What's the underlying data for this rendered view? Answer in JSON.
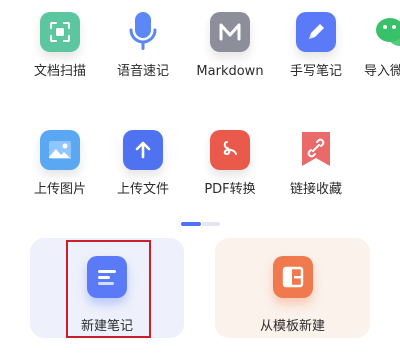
{
  "grid": {
    "row1": [
      {
        "label": "文档扫描",
        "icon": "scan-document-icon",
        "color": "#5cc6a1"
      },
      {
        "label": "语音速记",
        "icon": "microphone-icon",
        "color": "#5b87f7"
      },
      {
        "label": "Markdown",
        "icon": "markdown-m-icon",
        "color": "#8c8f99"
      },
      {
        "label": "手写笔记",
        "icon": "pencil-icon",
        "color": "#5b7af7"
      },
      {
        "label": "导入微",
        "icon": "wechat-icon",
        "color": "#39c16a"
      }
    ],
    "row2": [
      {
        "label": "上传图片",
        "icon": "image-icon",
        "color": "#5aa7f3"
      },
      {
        "label": "上传文件",
        "icon": "upload-arrow-icon",
        "color": "#4f73f0"
      },
      {
        "label": "PDF转换",
        "icon": "pdf-icon",
        "color": "#ea5a4b"
      },
      {
        "label": "链接收藏",
        "icon": "link-bookmark-icon",
        "color": "#ea6a6a"
      }
    ]
  },
  "cards": {
    "new_note": {
      "label": "新建笔记",
      "icon": "note-icon",
      "color": "#5b7af7",
      "bg": "#eef1fb"
    },
    "from_template": {
      "label": "从模板新建",
      "icon": "template-icon",
      "color": "#f07a4d",
      "bg": "#fbf2ec"
    }
  },
  "colors": {
    "accent": "#4c72ff",
    "highlight_border": "#c9202c"
  }
}
